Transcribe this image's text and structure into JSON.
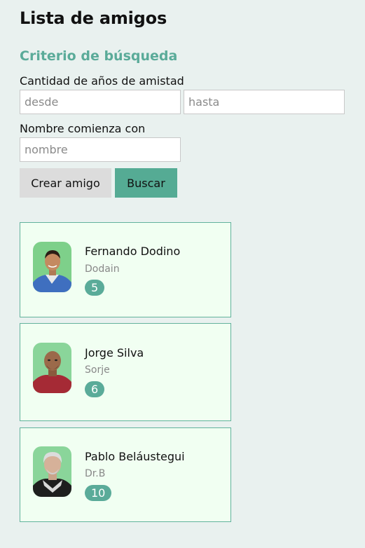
{
  "page_title": "Lista de amigos",
  "search": {
    "heading": "Criterio de búsqueda",
    "years_label": "Cantidad de años de amistad",
    "from_placeholder": "desde",
    "to_placeholder": "hasta",
    "name_label": "Nombre comienza con",
    "name_placeholder": "nombre",
    "create_button": "Crear amigo",
    "search_button": "Buscar"
  },
  "friends": [
    {
      "name": "Fernando Dodino",
      "nickname": "Dodain",
      "years": "5",
      "avatar_icon": "person-photo-avatar"
    },
    {
      "name": "Jorge Silva",
      "nickname": "Sorje",
      "years": "6",
      "avatar_icon": "person-photo-avatar"
    },
    {
      "name": "Pablo Beláustegui",
      "nickname": "Dr.B",
      "years": "10",
      "avatar_icon": "person-photo-avatar"
    }
  ],
  "colors": {
    "background": "#e9f1ef",
    "accent": "#5aab99",
    "card_background": "#f1fff2",
    "card_border": "#62b29c",
    "secondary_button": "#dcdcdc"
  }
}
